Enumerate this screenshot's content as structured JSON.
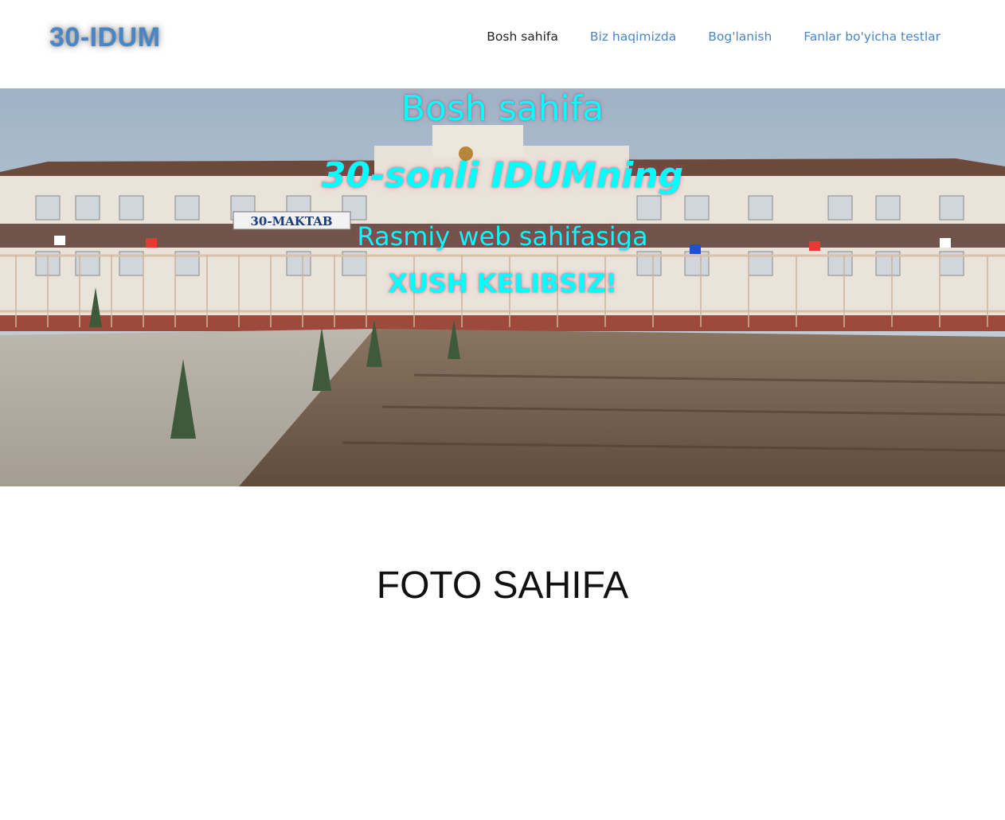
{
  "header": {
    "logo": "30-IDUM",
    "nav": [
      {
        "label": "Bosh sahifa",
        "active": true
      },
      {
        "label": "Biz haqimizda",
        "active": false
      },
      {
        "label": "Bog'lanish",
        "active": false
      },
      {
        "label": "Fanlar bo'yicha testlar",
        "active": false
      }
    ]
  },
  "hero": {
    "title": "Bosh sahifa",
    "subtitle": "30-sonli IDUMning",
    "line3": "Rasmiy web sahifasiga",
    "line4": "XUSH KELIBSIZ!",
    "sign_text": "30-MAKTAB",
    "text_color": "#00ffff"
  },
  "main": {
    "section_title": "FOTO SAHIFA"
  },
  "colors": {
    "link": "#4a86c5",
    "active_link": "#222222"
  }
}
